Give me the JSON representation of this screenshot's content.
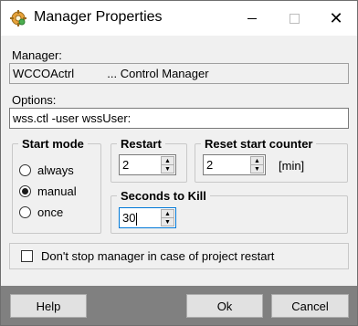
{
  "window": {
    "title": "Manager Properties",
    "icon": "gear-icon",
    "controls": {
      "minimize": "minimize-icon",
      "maximize": "maximize-icon",
      "close": "close-icon"
    },
    "close_glyph": "✕"
  },
  "manager": {
    "label": "Manager:",
    "value": "WCCOActrl          ... Control Manager"
  },
  "options": {
    "label": "Options:",
    "value": "wss.ctl -user wssUser:"
  },
  "start_mode": {
    "legend": "Start mode",
    "options": [
      {
        "label": "always",
        "selected": false
      },
      {
        "label": "manual",
        "selected": true
      },
      {
        "label": "once",
        "selected": false
      }
    ]
  },
  "restart": {
    "legend": "Restart",
    "value": "2"
  },
  "reset_counter": {
    "legend": "Reset start counter",
    "value": "2",
    "unit": "[min]"
  },
  "seconds_to_kill": {
    "legend": "Seconds to Kill",
    "value": "30"
  },
  "dont_stop": {
    "label": "Don't stop manager in case of project restart",
    "checked": false
  },
  "buttons": {
    "help": "Help",
    "ok": "Ok",
    "cancel": "Cancel"
  },
  "spinner_glyphs": {
    "up": "▲",
    "down": "▼"
  },
  "colors": {
    "focus_border": "#0078d7",
    "footer_bar": "#808080",
    "title_bar": "#ffffff"
  }
}
